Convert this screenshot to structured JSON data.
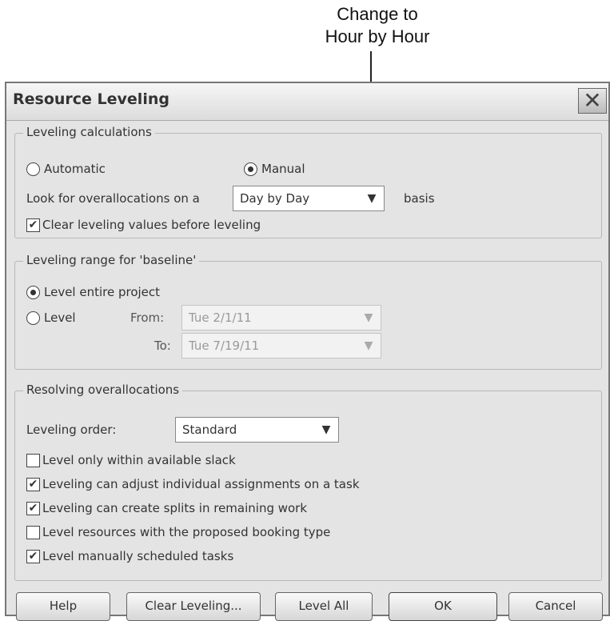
{
  "annotation": {
    "line1": "Change to",
    "line2": "Hour by Hour"
  },
  "dialog": {
    "title": "Resource Leveling",
    "close_glyph": "✕"
  },
  "calc": {
    "legend": "Leveling calculations",
    "automatic_label": "Automatic",
    "automatic_selected": false,
    "manual_label": "Manual",
    "manual_selected": true,
    "look_for_label": "Look for overallocations on a",
    "basis_value": "Day by Day",
    "basis_suffix": "basis",
    "clear_values_label": "Clear leveling values before leveling",
    "clear_values_checked": true
  },
  "range": {
    "legend": "Leveling range for 'baseline'",
    "entire_label": "Level entire project",
    "entire_selected": true,
    "level_label": "Level",
    "from_label": "From:",
    "from_value": "Tue 2/1/11",
    "to_label": "To:",
    "to_value": "Tue 7/19/11"
  },
  "resolving": {
    "legend": "Resolving overallocations",
    "order_label": "Leveling order:",
    "order_value": "Standard",
    "options": [
      {
        "label": "Level only within available slack",
        "checked": false
      },
      {
        "label": "Leveling can adjust individual assignments on a task",
        "checked": true
      },
      {
        "label": "Leveling can create splits in remaining work",
        "checked": true
      },
      {
        "label": "Level resources with the proposed booking type",
        "checked": false
      },
      {
        "label": "Level manually scheduled tasks",
        "checked": true
      }
    ]
  },
  "buttons": {
    "help": "Help",
    "clear_leveling": "Clear Leveling...",
    "level_all": "Level All",
    "ok": "OK",
    "cancel": "Cancel"
  },
  "icons": {
    "check": "✔",
    "dropdown": "▼"
  }
}
